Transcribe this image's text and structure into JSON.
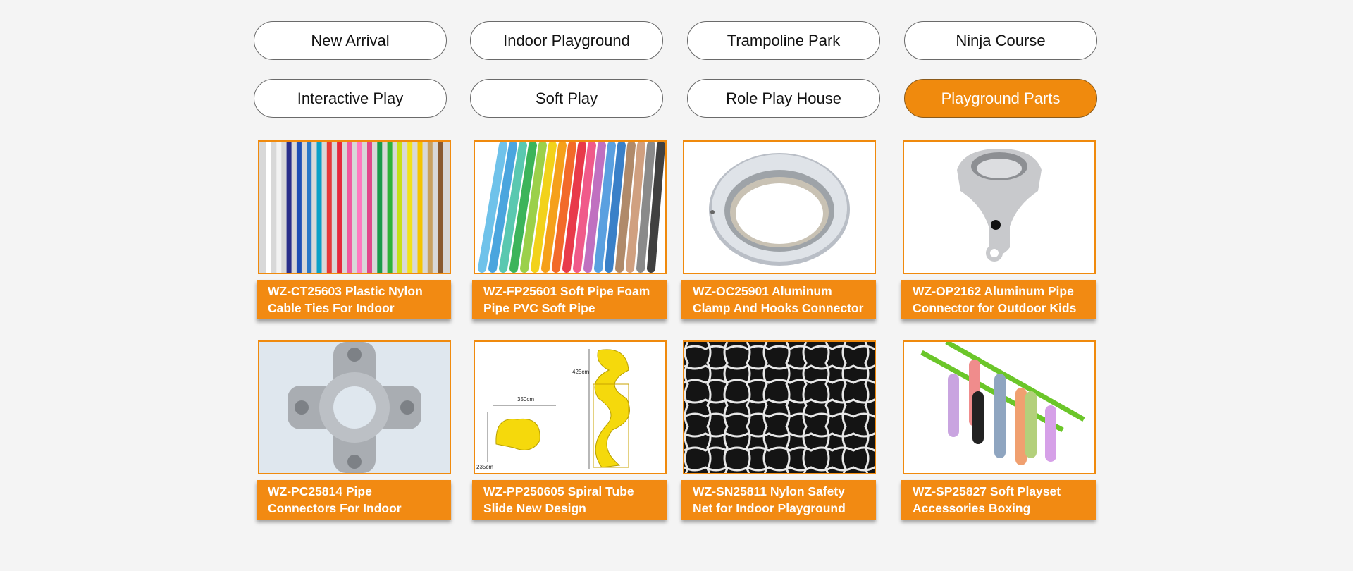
{
  "categories": [
    {
      "label": "New Arrival",
      "active": false
    },
    {
      "label": "Indoor Playground",
      "active": false
    },
    {
      "label": "Trampoline Park",
      "active": false
    },
    {
      "label": "Ninja Course",
      "active": false
    },
    {
      "label": "Interactive Play",
      "active": false
    },
    {
      "label": "Soft Play",
      "active": false
    },
    {
      "label": "Role Play House",
      "active": false
    },
    {
      "label": "Playground Parts",
      "active": true
    }
  ],
  "products": [
    {
      "line1": "WZ-CT25603 Plastic Nylon",
      "line2": "Cable Ties For Indoor",
      "image": "cable-ties-image"
    },
    {
      "line1": "WZ-FP25601 Soft Pipe Foam",
      "line2": "Pipe PVC Soft Pipe",
      "image": "foam-pipes-image"
    },
    {
      "line1": "WZ-OC25901 Aluminum",
      "line2": "Clamp And Hooks Connector",
      "image": "aluminum-clamp-image"
    },
    {
      "line1": "WZ-OP2162 Aluminum Pipe",
      "line2": "Connector for Outdoor Kids",
      "image": "pipe-connector-image"
    },
    {
      "line1": "WZ-PC25814 Pipe",
      "line2": "Connectors For Indoor",
      "image": "cross-connector-image"
    },
    {
      "line1": "WZ-PP250605 Spiral Tube",
      "line2": "Slide New Design",
      "image": "spiral-slide-image"
    },
    {
      "line1": "WZ-SN25811 Nylon Safety",
      "line2": "Net for Indoor Playground",
      "image": "safety-net-image"
    },
    {
      "line1": "WZ-SP25827 Soft Playset",
      "line2": "Accessories Boxing",
      "image": "boxing-bags-image"
    }
  ],
  "slide_dimensions": {
    "width": "350cm",
    "height": "425cm",
    "depth": "235cm"
  },
  "colors": {
    "accent": "#f08a0d",
    "caption_bg": "#f28a12",
    "background": "#f4f4f4"
  }
}
